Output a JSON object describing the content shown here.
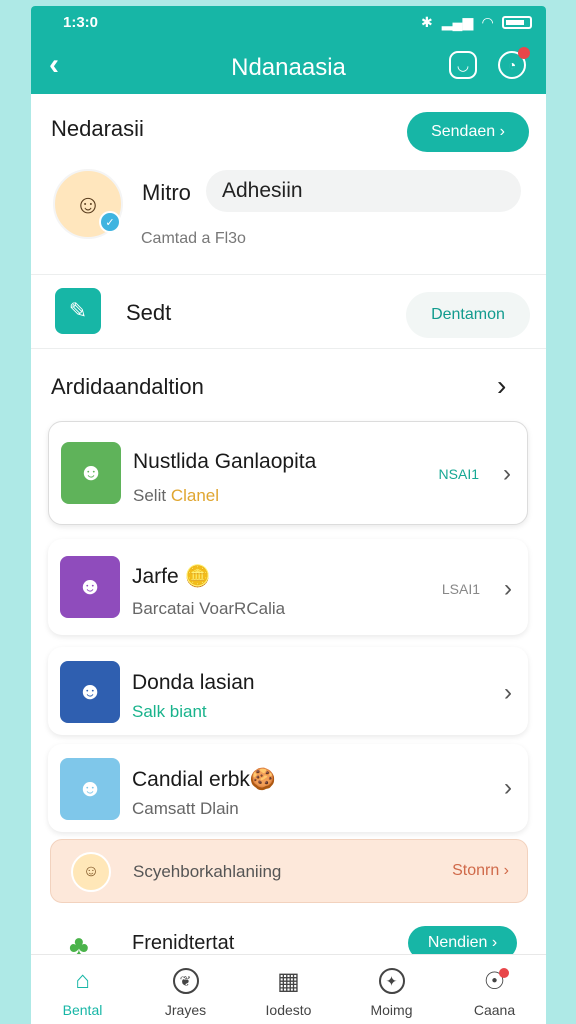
{
  "status": {
    "time": "1:3:0",
    "icons": [
      "bluetooth-icon",
      "signal-icon",
      "wifi-icon",
      "battery-icon"
    ]
  },
  "header": {
    "title": "Ndanaasia",
    "back": "‹"
  },
  "profile": {
    "section_title": "Nedarasii",
    "send_button": "Sendaen ›",
    "name": "Mitro",
    "search_value": "Adhesiin",
    "subtitle": "Camtad a Fl3o"
  },
  "edit": {
    "label": "Sedt",
    "button": "Dentamon"
  },
  "list": {
    "title": "Ardidaandaltion",
    "items": [
      {
        "name": "Nustlida Ganlaopita",
        "sub_a": "Selit",
        "sub_b": "Clanel",
        "tag": "NSAI1",
        "tag_color": "#17a894"
      },
      {
        "name": "Jarfe 🪙",
        "sub_a": "Barcatai VoarRCalia",
        "sub_b": "",
        "tag": "LSAI1",
        "tag_color": "#888888"
      },
      {
        "name": "Donda lasian",
        "sub_a": "Salk biant",
        "sub_b": "",
        "tag": "",
        "tag_color": "#888888"
      },
      {
        "name": "Candial erbk🍪",
        "sub_a": "Camsatt Dlain",
        "sub_b": "",
        "tag": "",
        "tag_color": "#888888"
      }
    ]
  },
  "promo": {
    "text": "Scyehborkahlaniing",
    "button": "Stonrn ›"
  },
  "friend": {
    "label": "Frenidtertat",
    "button": "Nendien ›"
  },
  "tabs": [
    {
      "label": "Bental",
      "icon": "home-icon"
    },
    {
      "label": "Jrayes",
      "icon": "leaf-icon"
    },
    {
      "label": "Iodesto",
      "icon": "calendar-icon"
    },
    {
      "label": "Moimg",
      "icon": "compass-icon"
    },
    {
      "label": "Caana",
      "icon": "profile-icon"
    }
  ],
  "colors": {
    "accent": "#17b6a6",
    "background": "#aee9e6",
    "alert": "#e8464a",
    "promo_bg": "#fde8da"
  }
}
